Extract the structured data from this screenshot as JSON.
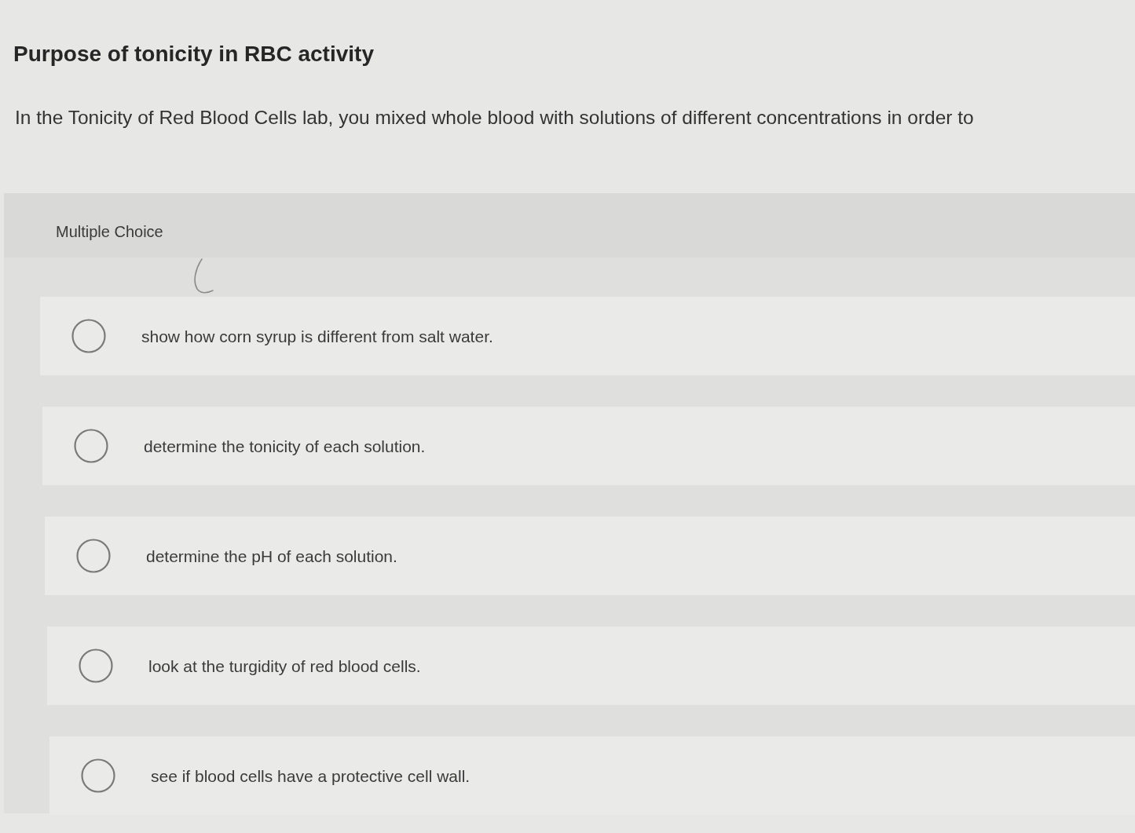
{
  "title": "Purpose of tonicity in RBC activity",
  "question": "In the Tonicity of Red Blood Cells lab, you mixed whole blood with solutions of different concentrations in order to",
  "panel": {
    "label": "Multiple Choice",
    "has_pen_mark": true
  },
  "options": [
    {
      "text": "show how corn syrup is different from salt water.",
      "selected": false
    },
    {
      "text": "determine the tonicity of each solution.",
      "selected": false
    },
    {
      "text": "determine the pH of each solution.",
      "selected": false
    },
    {
      "text": "look at the turgidity of red blood cells.",
      "selected": false
    },
    {
      "text": "see if blood cells have a protective cell wall.",
      "selected": false
    }
  ]
}
